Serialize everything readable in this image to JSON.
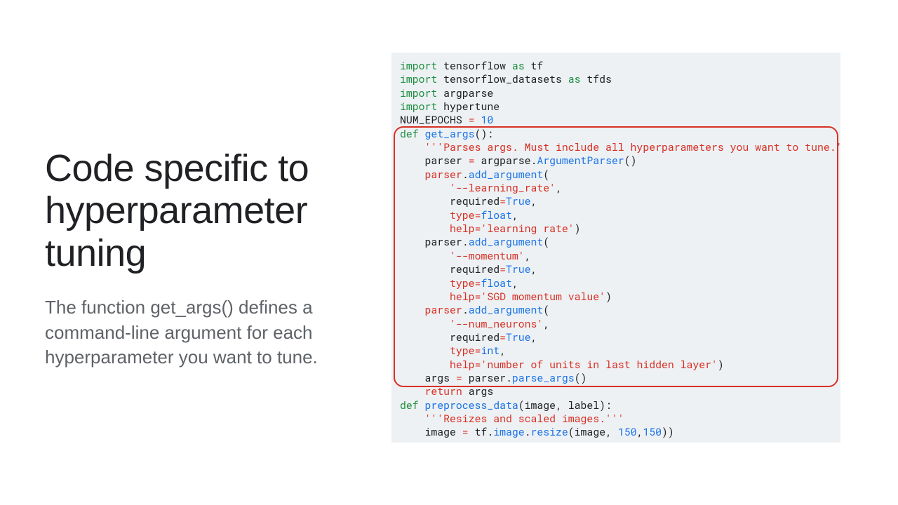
{
  "left": {
    "title": "Code specific to hyperparameter tuning",
    "desc": "The function get_args() defines a command-line argument for each hyperparameter you want to tune."
  },
  "code": {
    "l1": {
      "imp": "import",
      "a": " tensorflow ",
      "as": "as",
      "b": " tf"
    },
    "l2": {
      "imp": "import",
      "a": " tensorflow_datasets ",
      "as": "as",
      "b": " tfds"
    },
    "l3": {
      "imp": "import",
      "a": " argparse"
    },
    "l4": {
      "imp": "import",
      "a": " hypertune"
    },
    "l5": {
      "a": "NUM_EPOCHS ",
      "eq": "=",
      "b": " ",
      "n": "10"
    },
    "l6": {
      "def": "def",
      "fn": " get_args",
      "rest": "():"
    },
    "l7": {
      "s": "    ",
      "doc": "'''Parses args. Must include all hyperparameters you want to tune.'''"
    },
    "l8": {
      "s": "    parser ",
      "eq": "=",
      "a": " argparse",
      "dot": ".",
      "cls": "ArgumentParser",
      "rest": "()"
    },
    "l9": {
      "s": "    ",
      "obj": "parser",
      "dot": ".",
      "m": "add_argument",
      "rest": "("
    },
    "l10": {
      "s": "        ",
      "str": "'--learning_rate'",
      "rest": ","
    },
    "l11": {
      "s": "        required",
      "eq": "=",
      "v": "True",
      "rest": ","
    },
    "l12": {
      "s": "        ",
      "k": "type",
      "eq": "=",
      "v": "float",
      "rest": ","
    },
    "l13": {
      "s": "        ",
      "k": "help",
      "eq": "=",
      "str": "'learning rate'",
      "rest": ")"
    },
    "l14": {
      "s": "    parser",
      "dot": ".",
      "m": "add_argument",
      "rest": "("
    },
    "l15": {
      "s": "        ",
      "str": "'--momentum'",
      "rest": ","
    },
    "l16": {
      "s": "        required",
      "eq": "=",
      "v": "True",
      "rest": ","
    },
    "l17": {
      "s": "        ",
      "k": "type",
      "eq": "=",
      "v": "float",
      "rest": ","
    },
    "l18": {
      "s": "        ",
      "k": "help",
      "eq": "=",
      "str": "'SGD momentum value'",
      "rest": ")"
    },
    "l19": {
      "s": "    ",
      "obj": "parser",
      "dot": ".",
      "m": "add_argument",
      "rest": "("
    },
    "l20": {
      "s": "        ",
      "str": "'--num_neurons'",
      "rest": ","
    },
    "l21": {
      "s": "        required",
      "eq": "=",
      "v": "True",
      "rest": ","
    },
    "l22": {
      "s": "        ",
      "k": "type",
      "eq": "=",
      "v": "int",
      "rest": ","
    },
    "l23": {
      "s": "        ",
      "k": "help",
      "eq": "=",
      "str": "'number of units in last hidden layer'",
      "rest": ")"
    },
    "l24": {
      "s": "    args ",
      "eq": "=",
      "a": " parser",
      "dot": ".",
      "m": "parse_args",
      "rest": "()"
    },
    "l25": {
      "s": "    ",
      "ret": "return",
      "a": " args"
    },
    "l26": {
      "def": "def",
      "fn": " preprocess_data",
      "rest": "(image, label):"
    },
    "l27": {
      "s": "    ",
      "doc": "'''Resizes and scaled images.'''"
    },
    "l28": {
      "s": "    image ",
      "eq": "=",
      "a": " tf",
      "dot": ".",
      "m1": "image",
      "dot2": ".",
      "m2": "resize",
      "rest1": "(image, ",
      "n1": "150",
      "c": ",",
      "n2": "150",
      "rest2": "))"
    }
  }
}
